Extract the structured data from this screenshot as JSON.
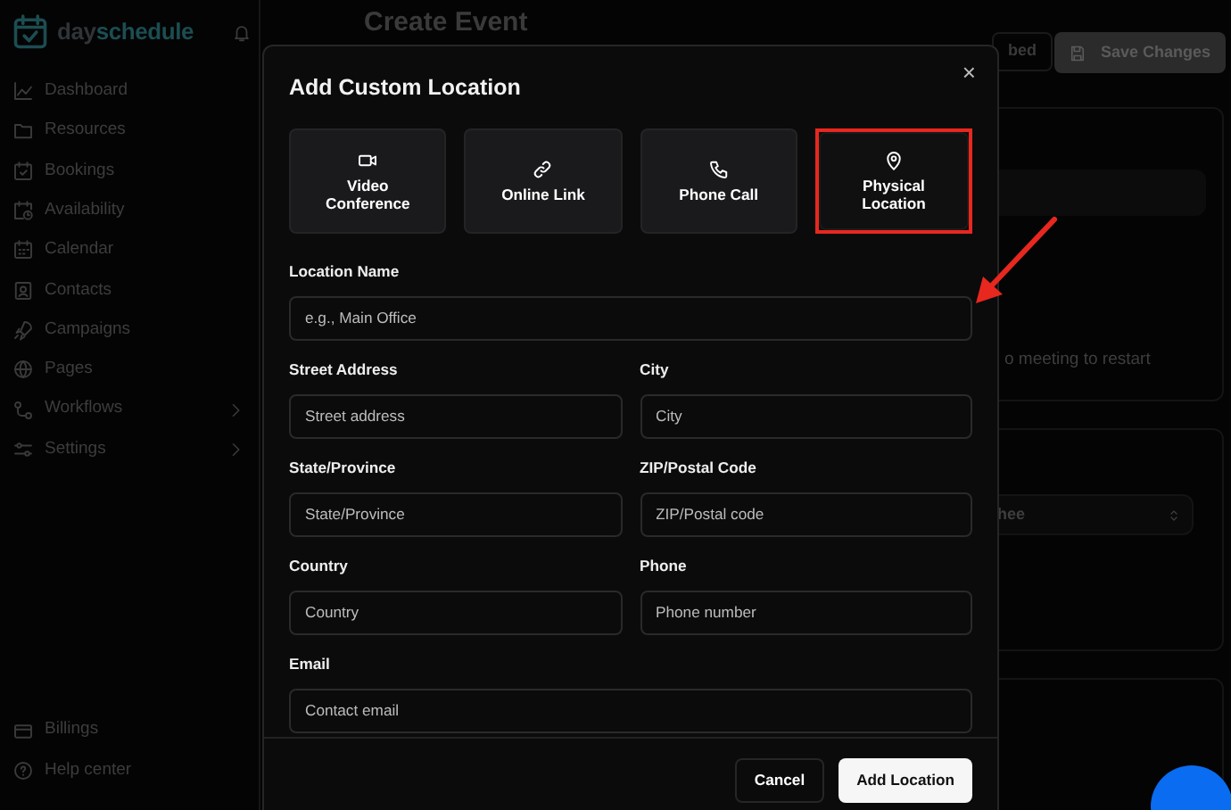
{
  "sidebar": {
    "logo": {
      "part_1": "day",
      "part_2": "schedule"
    },
    "items": [
      {
        "label": "Dashboard",
        "has_submenu": false
      },
      {
        "label": "Resources",
        "has_submenu": false
      },
      {
        "label": "Bookings",
        "has_submenu": false
      },
      {
        "label": "Availability",
        "has_submenu": false
      },
      {
        "label": "Calendar",
        "has_submenu": false
      },
      {
        "label": "Contacts",
        "has_submenu": false
      },
      {
        "label": "Campaigns",
        "has_submenu": false
      },
      {
        "label": "Pages",
        "has_submenu": false
      },
      {
        "label": "Workflows",
        "has_submenu": true
      },
      {
        "label": "Settings",
        "has_submenu": true
      }
    ],
    "bottom_items": [
      {
        "label": "Billings"
      },
      {
        "label": "Help center"
      }
    ]
  },
  "page": {
    "title": "Create Event",
    "buttons": [
      "bed",
      "Save Changes"
    ],
    "notice": "o meeting to restart",
    "select_value": "hee"
  },
  "dialog": {
    "title": "Add Custom Location",
    "close": "×",
    "location_types": [
      {
        "label": "Video Conference",
        "selected": false,
        "highlighted": false
      },
      {
        "label": "Online Link",
        "selected": false,
        "highlighted": false
      },
      {
        "label": "Phone Call",
        "selected": false,
        "highlighted": false
      },
      {
        "label": "Physical Location",
        "selected": true,
        "highlighted": true
      }
    ],
    "fields": [
      {
        "label": "Location Name",
        "placeholder": "e.g., Main Office",
        "kind": "wide"
      },
      {
        "label": "Street Address",
        "placeholder": "Street address",
        "kind": "half"
      },
      {
        "label": "City",
        "placeholder": "City",
        "kind": "half"
      },
      {
        "label": "State/Province",
        "placeholder": "State/Province",
        "kind": "half"
      },
      {
        "label": "ZIP/Postal Code",
        "placeholder": "ZIP/Postal code",
        "kind": "half"
      },
      {
        "label": "Country",
        "placeholder": "Country",
        "kind": "half"
      },
      {
        "label": "Phone",
        "placeholder": "Phone number",
        "kind": "half"
      },
      {
        "label": "Email",
        "placeholder": "Contact email",
        "kind": "wide"
      }
    ],
    "buttons": {
      "cancel": "Cancel",
      "submit": "Add Location"
    }
  }
}
